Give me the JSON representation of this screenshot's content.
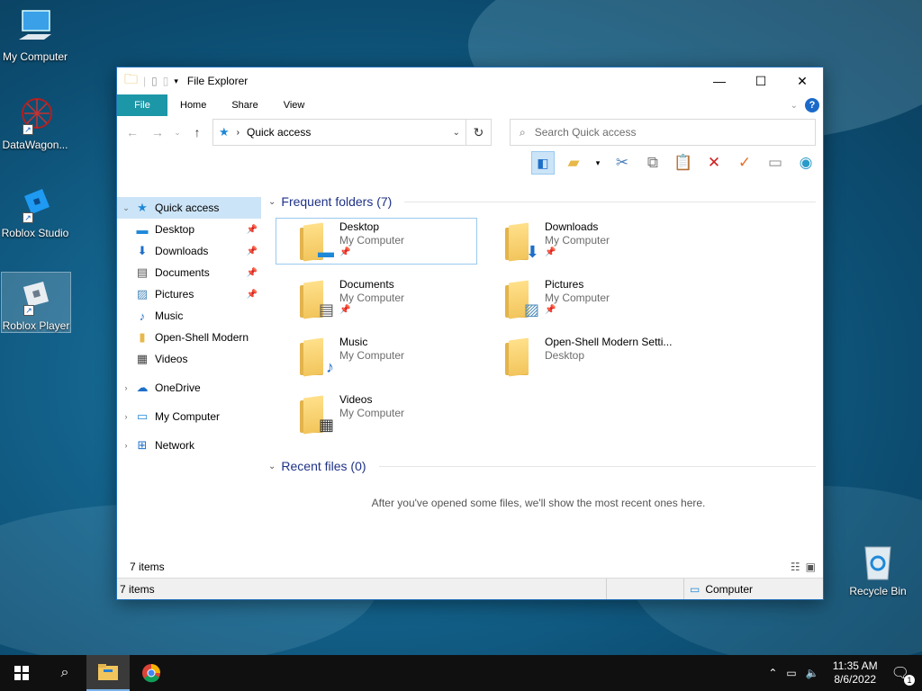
{
  "desktop": {
    "icons": [
      {
        "label": "My Computer"
      },
      {
        "label": "DataWagon..."
      },
      {
        "label": "Roblox Studio"
      },
      {
        "label": "Roblox Player"
      },
      {
        "label": "Recycle Bin"
      }
    ]
  },
  "window": {
    "title": "File Explorer",
    "tabs": [
      "File",
      "Home",
      "Share",
      "View"
    ],
    "address": "Quick access",
    "search_placeholder": "Search Quick access"
  },
  "sidebar": {
    "quick_access": "Quick access",
    "items": [
      "Desktop",
      "Downloads",
      "Documents",
      "Pictures",
      "Music",
      "Open-Shell Modern",
      "Videos"
    ],
    "onedrive": "OneDrive",
    "my_computer": "My Computer",
    "network": "Network"
  },
  "main": {
    "frequent_header": "Frequent folders (7)",
    "folders": [
      {
        "name": "Desktop",
        "location": "My Computer"
      },
      {
        "name": "Downloads",
        "location": "My Computer"
      },
      {
        "name": "Documents",
        "location": "My Computer"
      },
      {
        "name": "Pictures",
        "location": "My Computer"
      },
      {
        "name": "Music",
        "location": "My Computer"
      },
      {
        "name": "Open-Shell Modern Setti...",
        "location": "Desktop"
      },
      {
        "name": "Videos",
        "location": "My Computer"
      }
    ],
    "recent_header": "Recent files (0)",
    "recent_empty": "After you've opened some files, we'll show the most recent ones here."
  },
  "status": {
    "items_count": "7 items",
    "items_count_bar": "7 items",
    "location": "Computer"
  },
  "taskbar": {
    "time": "11:35 AM",
    "date": "8/6/2022",
    "notification_count": "1"
  }
}
